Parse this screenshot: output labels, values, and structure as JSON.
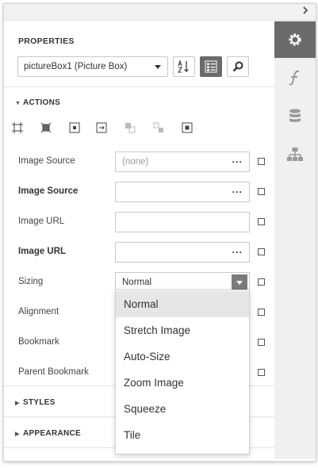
{
  "panel": {
    "title": "PROPERTIES",
    "object_selector": "pictureBox1 (Picture Box)",
    "toolbar": {
      "sort_alpha_icon": "sort-alphabetical-icon",
      "categorized_icon": "categorized-view-icon",
      "search_icon": "search-icon"
    }
  },
  "rail": {
    "tabs": [
      {
        "icon": "gear-icon",
        "active": true
      },
      {
        "icon": "function-icon",
        "active": false
      },
      {
        "icon": "database-icon",
        "active": false
      },
      {
        "icon": "hierarchy-icon",
        "active": false
      }
    ]
  },
  "sections": {
    "actions": "ACTIONS",
    "styles": "STYLES",
    "appearance": "APPEARANCE"
  },
  "properties": [
    {
      "label": "Image Source",
      "bold": false,
      "value": "(none)",
      "placeholder": true,
      "editor": "ellipsis"
    },
    {
      "label": "Image Source",
      "bold": true,
      "value": "",
      "placeholder": false,
      "editor": "ellipsis"
    },
    {
      "label": "Image URL",
      "bold": false,
      "value": "",
      "placeholder": false,
      "editor": "text"
    },
    {
      "label": "Image URL",
      "bold": true,
      "value": "",
      "placeholder": false,
      "editor": "ellipsis"
    },
    {
      "label": "Sizing",
      "bold": false,
      "value": "Normal",
      "placeholder": false,
      "editor": "dropdown"
    },
    {
      "label": "Alignment",
      "bold": false
    },
    {
      "label": "Bookmark",
      "bold": false
    },
    {
      "label": "Parent Bookmark",
      "bold": false
    }
  ],
  "sizing_options": [
    "Normal",
    "Stretch Image",
    "Auto-Size",
    "Zoom Image",
    "Squeeze",
    "Tile"
  ],
  "colors": {
    "active_tab": "#6b6b6b",
    "rail_bg": "#f0f0f0",
    "selected_option": "#e6e6e6"
  }
}
